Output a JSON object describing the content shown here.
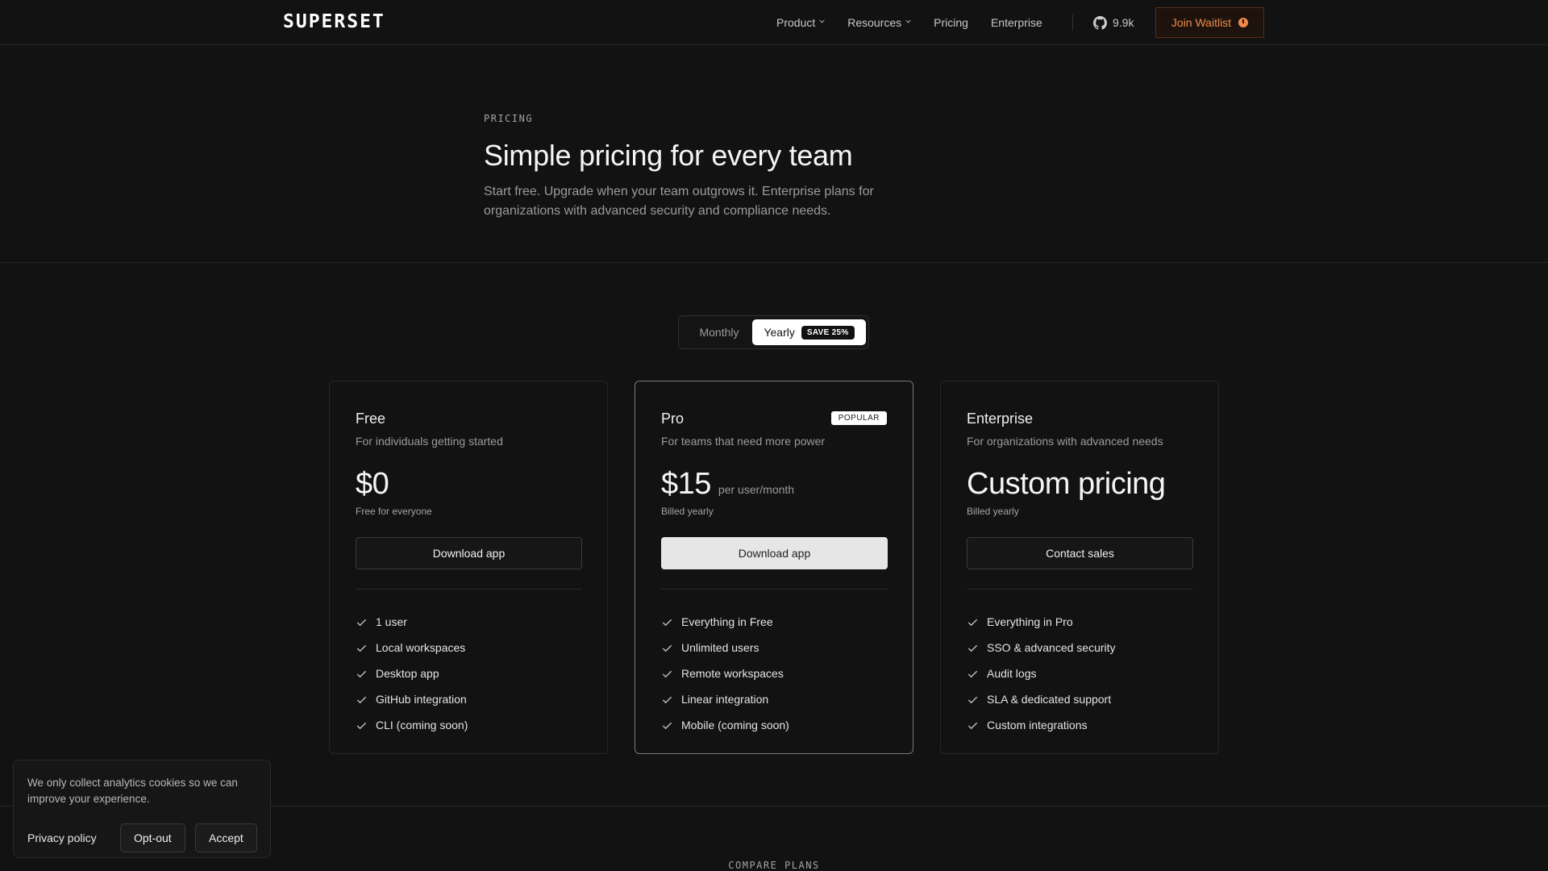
{
  "nav": {
    "logo": "SUPERSET",
    "links": [
      {
        "label": "Product"
      },
      {
        "label": "Resources"
      },
      {
        "label": "Pricing"
      },
      {
        "label": "Enterprise"
      }
    ],
    "github_stars": "9.9k",
    "cta": "Join Waitlist"
  },
  "hero": {
    "eyebrow": "PRICING",
    "title": "Simple pricing for every team",
    "subtitle": "Start free. Upgrade when your team outgrows it. Enterprise plans for organizations with advanced security and compliance needs."
  },
  "billing_toggle": {
    "monthly": "Monthly",
    "yearly": "Yearly",
    "badge": "SAVE 25%",
    "selected": "Yearly"
  },
  "plans": [
    {
      "name": "Free",
      "description": "For individuals getting started",
      "price": "$0",
      "unit": "",
      "billing": "Free for everyone",
      "button": "Download app",
      "features": [
        "1 user",
        "Local workspaces",
        "Desktop app",
        "GitHub integration",
        "CLI (coming soon)"
      ]
    },
    {
      "name": "Pro",
      "badge": "POPULAR",
      "description": "For teams that need more power",
      "price": "$15",
      "unit": "per user/month",
      "billing": "Billed yearly",
      "button": "Download app",
      "features": [
        "Everything in Free",
        "Unlimited users",
        "Remote workspaces",
        "Linear integration",
        "Mobile (coming soon)"
      ]
    },
    {
      "name": "Enterprise",
      "description": "For organizations with advanced needs",
      "price": "Custom pricing",
      "unit": "",
      "billing": "Billed yearly",
      "button": "Contact sales",
      "features": [
        "Everything in Pro",
        "SSO & advanced security",
        "Audit logs",
        "SLA & dedicated support",
        "Custom integrations"
      ]
    }
  ],
  "compare": {
    "label": "COMPARE PLANS"
  },
  "cookie": {
    "message": "We only collect analytics cookies so we can improve your experience.",
    "privacy": "Privacy policy",
    "opt_out": "Opt-out",
    "accept": "Accept"
  },
  "colors": {
    "background": "#121212",
    "accent": "#f08a4b",
    "border": "#262626",
    "pro_border": "#7a7a7a"
  },
  "icons": [
    "chevron-down-icon",
    "github-icon",
    "clock-icon",
    "check-icon"
  ]
}
